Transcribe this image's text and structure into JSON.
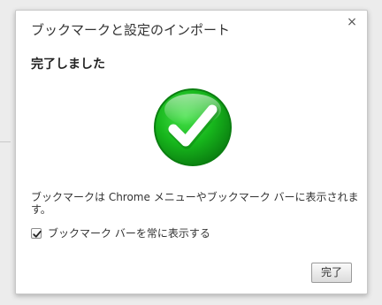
{
  "dialog": {
    "title": "ブックマークと設定のインポート",
    "close_glyph": "×",
    "heading": "完了しました",
    "message": "ブックマークは Chrome メニューやブックマーク バーに表示されます。",
    "checkbox": {
      "label": "ブックマーク バーを常に表示する",
      "checked": true
    },
    "done_label": "完了"
  },
  "colors": {
    "success_green": "#17b61c",
    "success_green_dark": "#0a7e10"
  },
  "icons": {
    "close": "close-icon",
    "success": "success-check-icon",
    "checkbox_check": "check-icon"
  }
}
